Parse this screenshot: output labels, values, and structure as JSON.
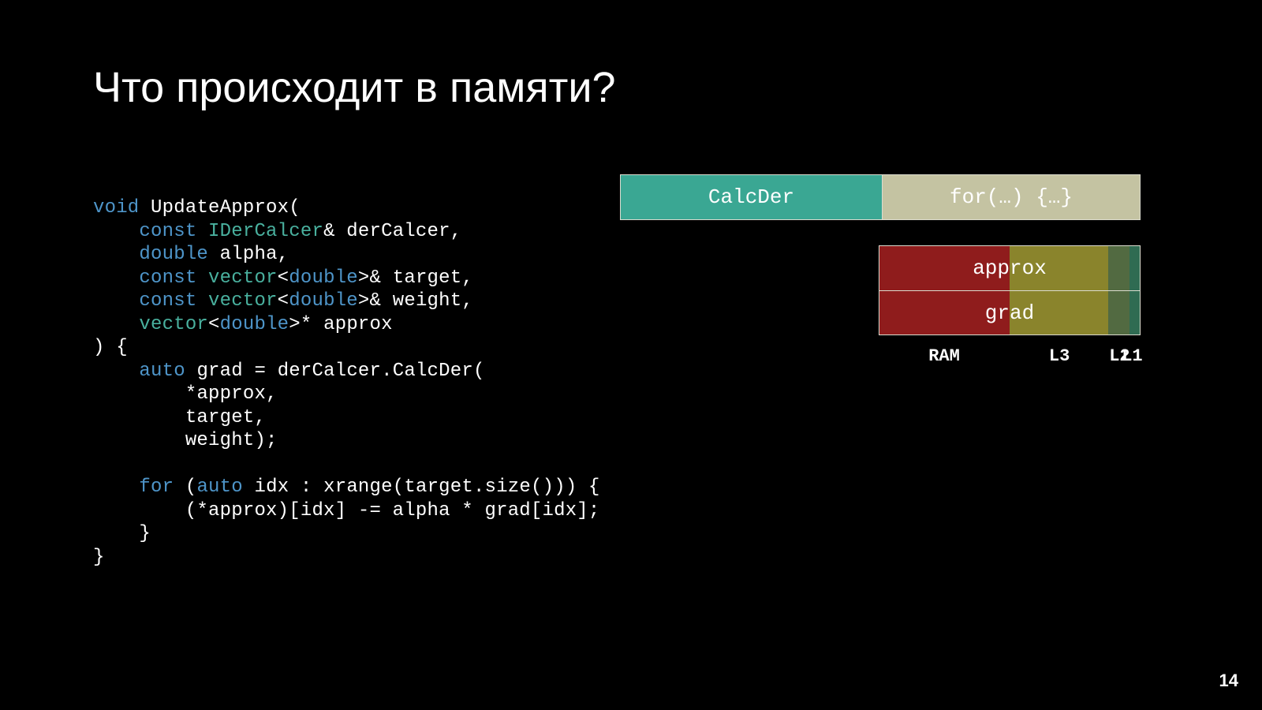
{
  "title": "Что происходит в памяти?",
  "page_number": "14",
  "code": {
    "l1": {
      "kw_void": "void",
      "sp": " ",
      "fn": "UpdateApprox",
      "open": "("
    },
    "l2": {
      "indent": "    ",
      "kw": "const",
      "sp": " ",
      "type": "IDerCalcer",
      "amp": "&",
      "sp2": " ",
      "id": "derCalcer",
      "c": ","
    },
    "l3": {
      "indent": "    ",
      "kw": "double",
      "sp": " ",
      "id": "alpha",
      "c": ","
    },
    "l4": {
      "indent": "    ",
      "kw": "const",
      "sp": " ",
      "type": "vector",
      "lt": "<",
      "inner": "double",
      "gt": ">",
      "amp": "&",
      "sp2": " ",
      "id": "target",
      "c": ","
    },
    "l5": {
      "indent": "    ",
      "kw": "const",
      "sp": " ",
      "type": "vector",
      "lt": "<",
      "inner": "double",
      "gt": ">",
      "amp": "&",
      "sp2": " ",
      "id": "weight",
      "c": ","
    },
    "l6": {
      "indent": "    ",
      "type": "vector",
      "lt": "<",
      "inner": "double",
      "gt": ">",
      "star": "*",
      "sp": " ",
      "id": "approx"
    },
    "l7": {
      "close": ")",
      "sp": " ",
      "brace": "{"
    },
    "l8": {
      "indent": "    ",
      "kw": "auto",
      "sp": " ",
      "id": "grad",
      "sp2": " ",
      "eq": "=",
      "sp3": " ",
      "obj": "derCalcer",
      "dot": ".",
      "fn": "CalcDer",
      "open": "("
    },
    "l9": {
      "indent": "        ",
      "star": "*",
      "id": "approx",
      "c": ","
    },
    "l10": {
      "indent": "        ",
      "id": "target",
      "c": ","
    },
    "l11": {
      "indent": "        ",
      "id": "weight",
      "close": ");"
    },
    "l12": {
      "blank": ""
    },
    "l13": {
      "indent": "    ",
      "kw": "for",
      "sp": " ",
      "open": "(",
      "kw2": "auto",
      "sp2": " ",
      "id": "idx",
      "sp3": " ",
      "colon": ":",
      "sp4": " ",
      "fn": "xrange",
      "open2": "(",
      "id2": "target",
      "dot": ".",
      "m": "size",
      "p": "()))",
      "sp5": " ",
      "brace": "{"
    },
    "l14": {
      "indent": "        ",
      "expr": "(*approx)[idx] -= alpha * grad[idx];"
    },
    "l15": {
      "indent": "    ",
      "brace": "}"
    },
    "l16": {
      "brace": "}"
    }
  },
  "diagram": {
    "timeline": {
      "calc": "CalcDer",
      "forloop": "for(…) {…}"
    },
    "mem_rows": [
      {
        "label": "approx",
        "ram_pct": 50,
        "l3_pct": 38,
        "l2_pct": 8,
        "l1_pct": 4
      },
      {
        "label": "grad",
        "ram_pct": 50,
        "l3_pct": 38,
        "l2_pct": 8,
        "l1_pct": 4
      }
    ],
    "axis": {
      "ram": "RAM",
      "l3": "L3",
      "l2": "L2",
      "l1": "L1"
    },
    "axis_pos": {
      "ram": 25,
      "l3": 69,
      "l2": 92,
      "l1": 100
    }
  }
}
